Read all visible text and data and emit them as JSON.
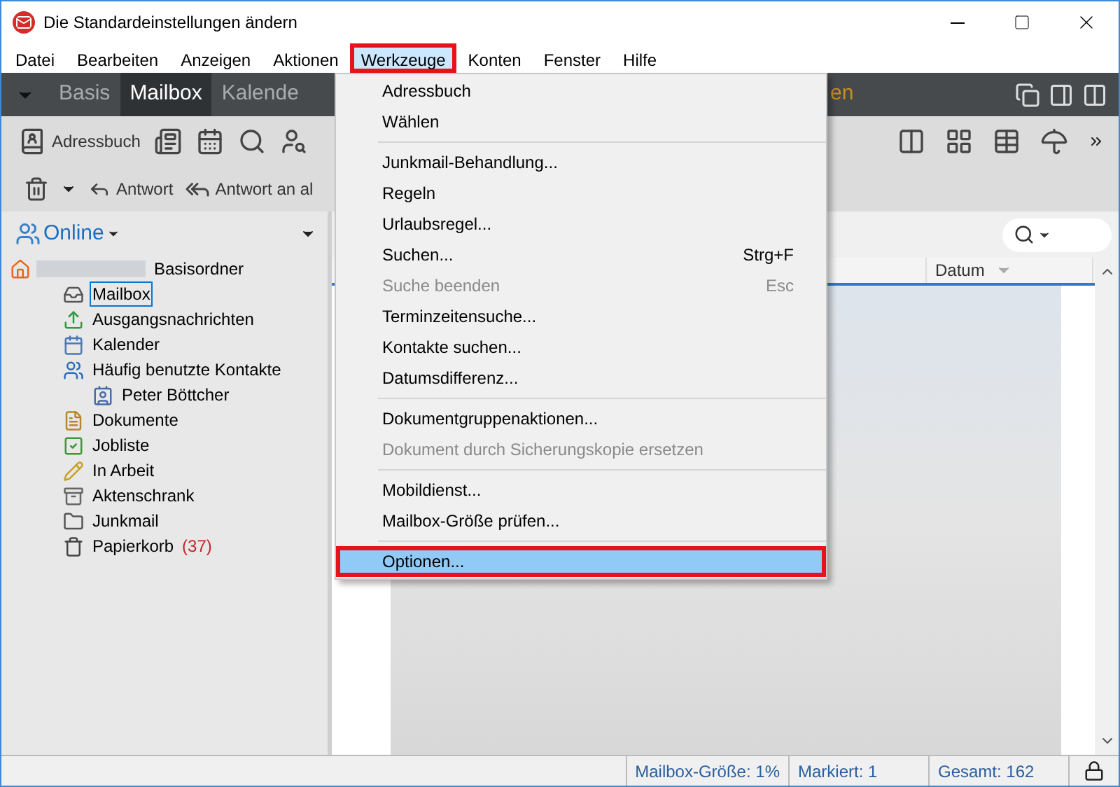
{
  "window": {
    "title": "Die Standardeinstellungen ändern"
  },
  "menu_bar": [
    {
      "label": "Datei",
      "open": false,
      "annotated": false
    },
    {
      "label": "Bearbeiten",
      "open": false,
      "annotated": false
    },
    {
      "label": "Anzeigen",
      "open": false,
      "annotated": false
    },
    {
      "label": "Aktionen",
      "open": false,
      "annotated": false
    },
    {
      "label": "Werkzeuge",
      "open": true,
      "annotated": true
    },
    {
      "label": "Konten",
      "open": false,
      "annotated": false
    },
    {
      "label": "Fenster",
      "open": false,
      "annotated": false
    },
    {
      "label": "Hilfe",
      "open": false,
      "annotated": false
    }
  ],
  "view_tabs": [
    {
      "label": "Basis",
      "selected": false
    },
    {
      "label": "Mailbox",
      "selected": true
    },
    {
      "label": "Kalende",
      "selected": false
    },
    {
      "label": "en",
      "selected": false
    }
  ],
  "toolbar": {
    "address_book_button": "Adressbuch",
    "reply_button": "Antwort",
    "reply_all_button": "Antwort an al"
  },
  "folder_pane": {
    "account_selector": "Online",
    "tree": {
      "label": "Basisordner",
      "kind": "home",
      "children": [
        {
          "label": "Mailbox",
          "kind": "inbox",
          "selected": true
        },
        {
          "label": "Ausgangsnachrichten",
          "kind": "outbox",
          "selected": false
        },
        {
          "label": "Kalender",
          "kind": "calendar",
          "selected": false
        },
        {
          "label": "Häufig benutzte Kontakte",
          "kind": "contacts",
          "selected": false,
          "children": [
            {
              "label": "Peter Böttcher",
              "kind": "contact",
              "selected": false
            }
          ]
        },
        {
          "label": "Dokumente",
          "kind": "documents",
          "selected": false
        },
        {
          "label": "Jobliste",
          "kind": "tasks",
          "selected": false
        },
        {
          "label": "In Arbeit",
          "kind": "drafts",
          "selected": false
        },
        {
          "label": "Aktenschrank",
          "kind": "cabinet",
          "selected": false
        },
        {
          "label": "Junkmail",
          "kind": "folder",
          "selected": false
        },
        {
          "label": "Papierkorb",
          "kind": "trash",
          "selected": false,
          "count": "(37)"
        }
      ]
    }
  },
  "message_list": {
    "columns": [
      "Datum"
    ]
  },
  "tools_menu": [
    {
      "kind": "item",
      "label": "Adressbuch",
      "disabled": false,
      "selected": false,
      "annotated": false
    },
    {
      "kind": "item",
      "label": "Wählen",
      "disabled": false,
      "selected": false,
      "annotated": false
    },
    {
      "kind": "separator"
    },
    {
      "kind": "item",
      "label": "Junkmail-Behandlung...",
      "disabled": false,
      "selected": false,
      "annotated": false
    },
    {
      "kind": "item",
      "label": "Regeln",
      "disabled": false,
      "selected": false,
      "annotated": false
    },
    {
      "kind": "item",
      "label": "Urlaubsregel...",
      "disabled": false,
      "selected": false,
      "annotated": false
    },
    {
      "kind": "item",
      "label": "Suchen...",
      "shortcut": "Strg+F",
      "disabled": false,
      "selected": false,
      "annotated": false
    },
    {
      "kind": "item",
      "label": "Suche beenden",
      "shortcut": "Esc",
      "disabled": true,
      "selected": false,
      "annotated": false
    },
    {
      "kind": "item",
      "label": "Terminzeitensuche...",
      "disabled": false,
      "selected": false,
      "annotated": false
    },
    {
      "kind": "item",
      "label": "Kontakte suchen...",
      "disabled": false,
      "selected": false,
      "annotated": false
    },
    {
      "kind": "item",
      "label": "Datumsdifferenz...",
      "disabled": false,
      "selected": false,
      "annotated": false
    },
    {
      "kind": "separator"
    },
    {
      "kind": "item",
      "label": "Dokumentgruppenaktionen...",
      "disabled": false,
      "selected": false,
      "annotated": false
    },
    {
      "kind": "item",
      "label": "Dokument durch Sicherungskopie ersetzen",
      "disabled": true,
      "selected": false,
      "annotated": false
    },
    {
      "kind": "separator"
    },
    {
      "kind": "item",
      "label": "Mobildienst...",
      "disabled": false,
      "selected": false,
      "annotated": false
    },
    {
      "kind": "item",
      "label": "Mailbox-Größe prüfen...",
      "disabled": false,
      "selected": false,
      "annotated": false
    },
    {
      "kind": "separator"
    },
    {
      "kind": "item",
      "label": "Optionen...",
      "disabled": false,
      "selected": true,
      "annotated": true
    }
  ],
  "status_bar": [
    "Mailbox-Größe: 1%",
    "Markiert: 1",
    "Gesamt: 162"
  ]
}
